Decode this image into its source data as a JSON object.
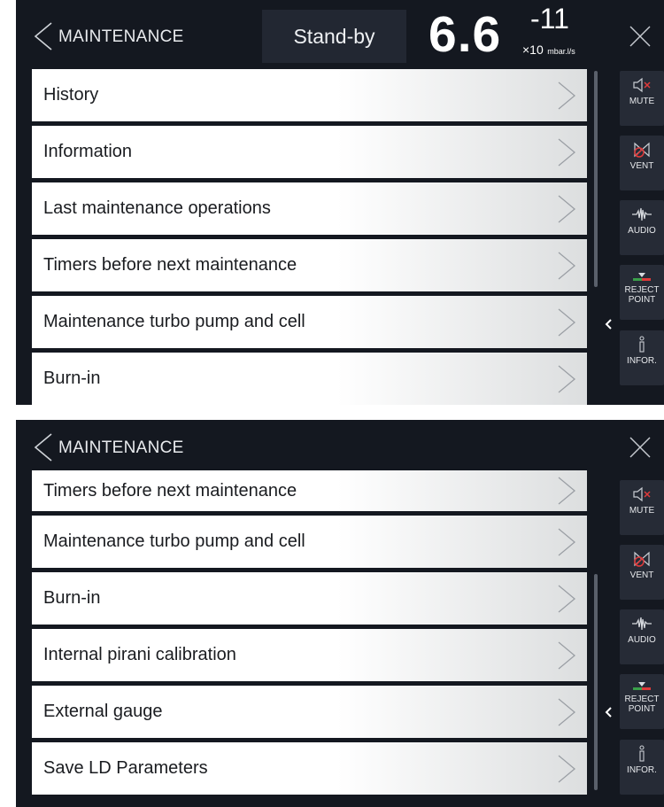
{
  "screen1": {
    "title": "MAINTENANCE",
    "mode": "Stand-by",
    "leak_rate": {
      "mantissa": "6.6",
      "exponent": "-11",
      "multiplier": "×10",
      "unit": "mbar.l/s"
    },
    "items": [
      {
        "label": "History"
      },
      {
        "label": "Information"
      },
      {
        "label": "Last maintenance operations"
      },
      {
        "label": "Timers before next maintenance"
      },
      {
        "label": "Maintenance turbo pump and cell"
      },
      {
        "label": "Burn-in"
      }
    ]
  },
  "screen2": {
    "title": "MAINTENANCE",
    "items": [
      {
        "label": "Timers before next maintenance"
      },
      {
        "label": "Maintenance turbo pump and cell"
      },
      {
        "label": "Burn-in"
      },
      {
        "label": "Internal pirani calibration"
      },
      {
        "label": "External gauge"
      },
      {
        "label": "Save LD Parameters"
      }
    ]
  },
  "sidebar": {
    "mute": "MUTE",
    "vent": "VENT",
    "audio": "AUDIO",
    "reject_point": "REJECT POINT",
    "infor": "INFOR."
  },
  "icons": {
    "back": "chevron-left-icon",
    "close": "close-icon",
    "item": "chevron-right-icon",
    "mute": "speaker-mute-icon",
    "vent": "vent-valve-icon",
    "audio": "waveform-icon",
    "reject_point": "reject-point-icon",
    "infor": "info-icon"
  },
  "colors": {
    "background": "#141820",
    "panel": "#262b36",
    "mute_x": "#e03a3a",
    "reject_green": "#3aa04a",
    "reject_red": "#e03a3a"
  }
}
